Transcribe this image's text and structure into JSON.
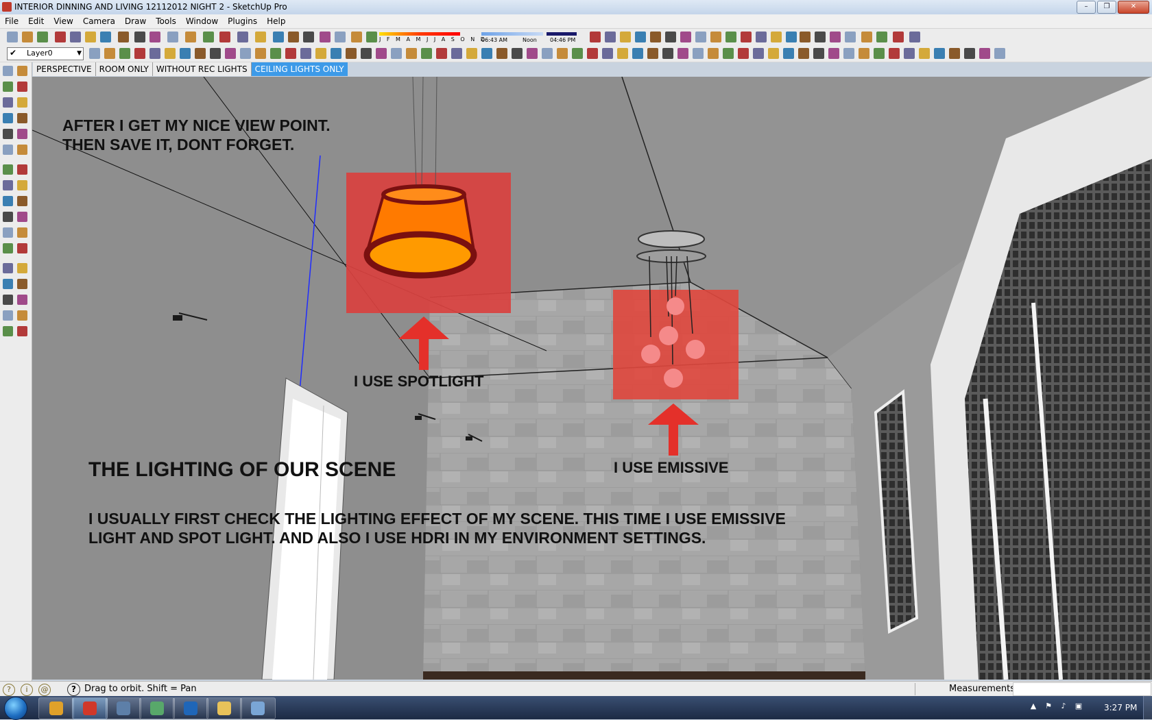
{
  "window": {
    "title": "INTERIOR DINNING AND LIVING 12112012 NIGHT 2 - SketchUp Pro"
  },
  "menu": [
    "File",
    "Edit",
    "View",
    "Camera",
    "Draw",
    "Tools",
    "Window",
    "Plugins",
    "Help"
  ],
  "toolbar": {
    "layer_select": "Layer0",
    "shadow_months": "J F M A M J J A S O N D",
    "time_start": "06:43 AM",
    "time_noon": "Noon",
    "time_end": "04:46 PM"
  },
  "scenes": [
    {
      "label": "PERSPECTIVE",
      "active": false
    },
    {
      "label": "ROOM ONLY",
      "active": false
    },
    {
      "label": "WITHOUT REC LIGHTS",
      "active": false
    },
    {
      "label": "CEILING LIGHTS ONLY",
      "active": true
    }
  ],
  "annotations": {
    "viewpoint_line1": "AFTER I GET MY NICE VIEW POINT.",
    "viewpoint_line2": "THEN SAVE IT, DONT FORGET.",
    "spotlight_label": "I USE SPOTLIGHT",
    "emissive_label": "I USE EMISSIVE",
    "heading": "THE LIGHTING OF OUR SCENE",
    "body_line1": "I USUALLY FIRST CHECK THE LIGHTING EFFECT OF MY SCENE. THIS TIME I USE EMISSIVE",
    "body_line2": "LIGHT AND SPOT LIGHT. AND ALSO I USE HDRI IN MY ENVIRONMENT SETTINGS."
  },
  "status": {
    "message": "Drag to orbit.  Shift = Pan",
    "measurements_label": "Measurements",
    "measurements_value": ""
  },
  "taskbar": {
    "apps": [
      {
        "name": "chrome-icon",
        "color": "#e0a12a"
      },
      {
        "name": "sketchup-icon",
        "color": "#d0382a"
      },
      {
        "name": "remote-icon",
        "color": "#5d7fa8"
      },
      {
        "name": "network-icon",
        "color": "#58a86a"
      },
      {
        "name": "photoshop-icon",
        "color": "#1f66b8"
      },
      {
        "name": "folder-icon",
        "color": "#e8c25a"
      },
      {
        "name": "window-icon",
        "color": "#7aa6d6"
      }
    ],
    "clock": "3:27 PM"
  },
  "colors": {
    "accent_tab": "#3d9ae8",
    "highlight_box": "#d9413f",
    "arrow": "#e4302a",
    "lampshade": "#ff7a00"
  }
}
